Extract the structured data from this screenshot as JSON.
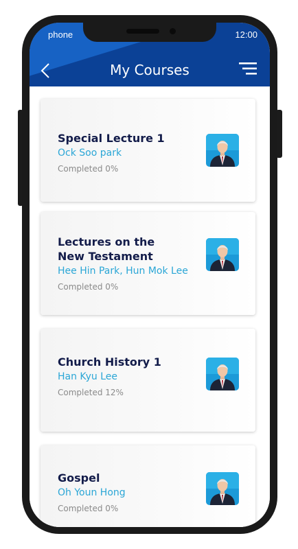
{
  "status_bar": {
    "carrier": "phone",
    "time": "12:00"
  },
  "header": {
    "title": "My Courses",
    "back_icon": "chevron-left-icon",
    "menu_icon": "hamburger-menu-icon"
  },
  "colors": {
    "header_bg": "#0b4196",
    "header_sheen": "#1762c4",
    "title_text": "#131c4a",
    "lecturer_text": "#2aa6d6",
    "progress_text": "#8a8a8a",
    "avatar_bg": "#1c9ad8"
  },
  "courses": [
    {
      "title_lines": [
        "Special Lecture 1"
      ],
      "lecturer": "Ock Soo park",
      "progress_label": "Completed 0%",
      "progress": 0
    },
    {
      "title_lines": [
        "Lectures on the",
        "New Testament"
      ],
      "lecturer": "Hee Hin Park, Hun Mok Lee",
      "progress_label": "Completed 0%",
      "progress": 0
    },
    {
      "title_lines": [
        "Church History 1"
      ],
      "lecturer": "Han Kyu Lee",
      "progress_label": "Completed 12%",
      "progress": 12
    },
    {
      "title_lines": [
        "Gospel"
      ],
      "lecturer": "Oh Youn Hong",
      "progress_label": "Completed 0%",
      "progress": 0
    }
  ]
}
